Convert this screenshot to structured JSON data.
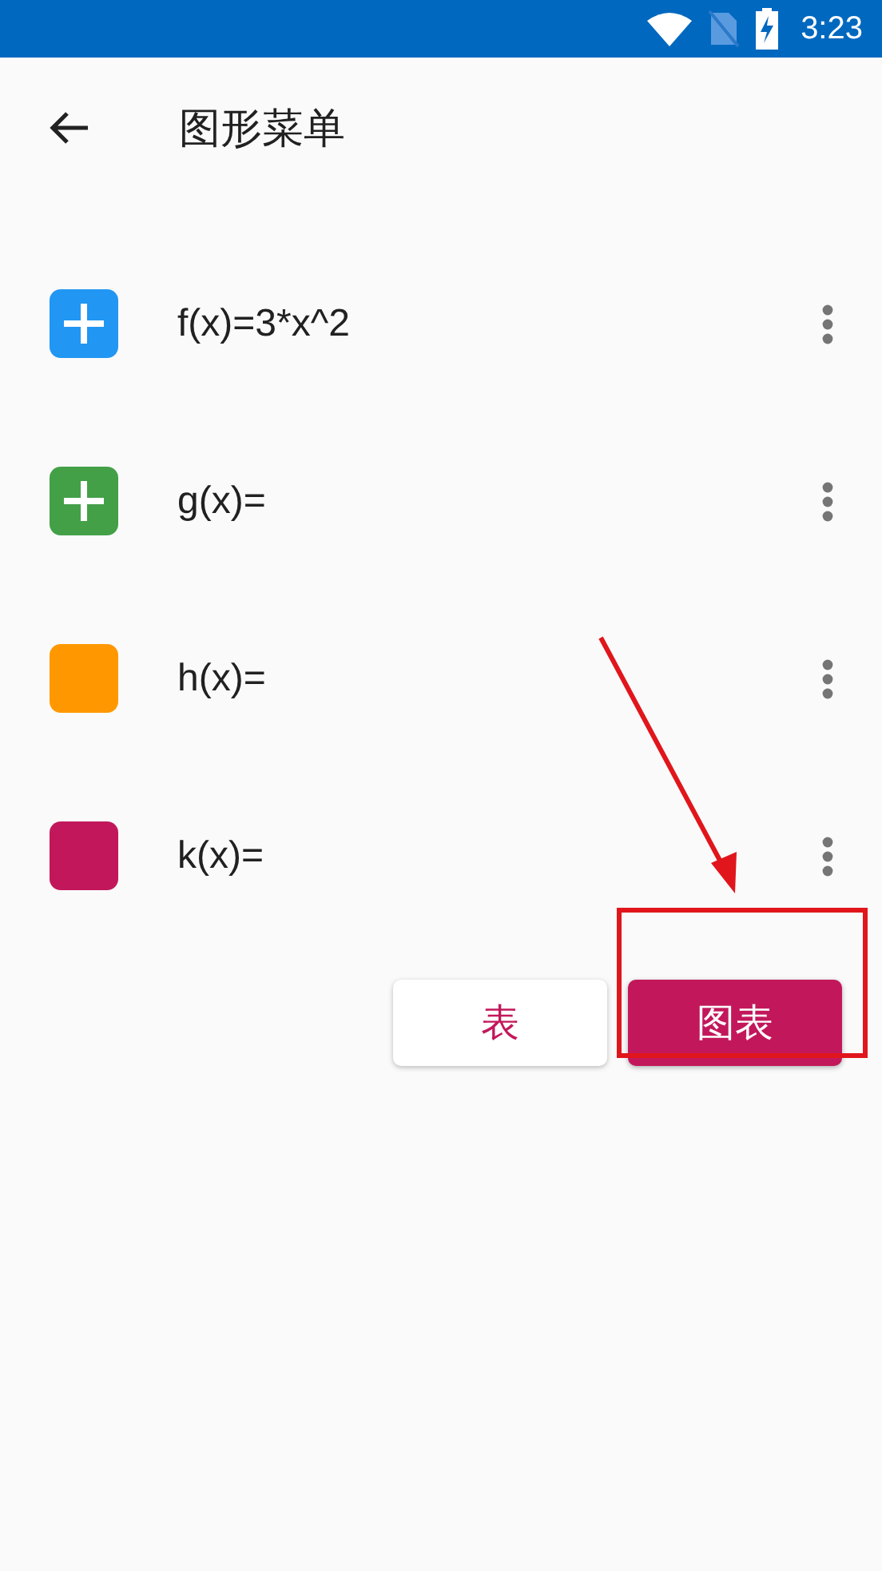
{
  "status_bar": {
    "time": "3:23"
  },
  "toolbar": {
    "title": "图形菜单"
  },
  "functions": [
    {
      "label": "f(x)=3*x^2",
      "kind": "plus",
      "color": "#2196f3"
    },
    {
      "label": "g(x)=",
      "kind": "plus",
      "color": "#43a047"
    },
    {
      "label": "h(x)=",
      "kind": "plain",
      "color": "#ff9800"
    },
    {
      "label": "k(x)=",
      "kind": "plain",
      "color": "#c2185b"
    }
  ],
  "buttons": [
    {
      "label": "表",
      "kind": "outlined"
    },
    {
      "label": "图表",
      "kind": "filled"
    }
  ]
}
